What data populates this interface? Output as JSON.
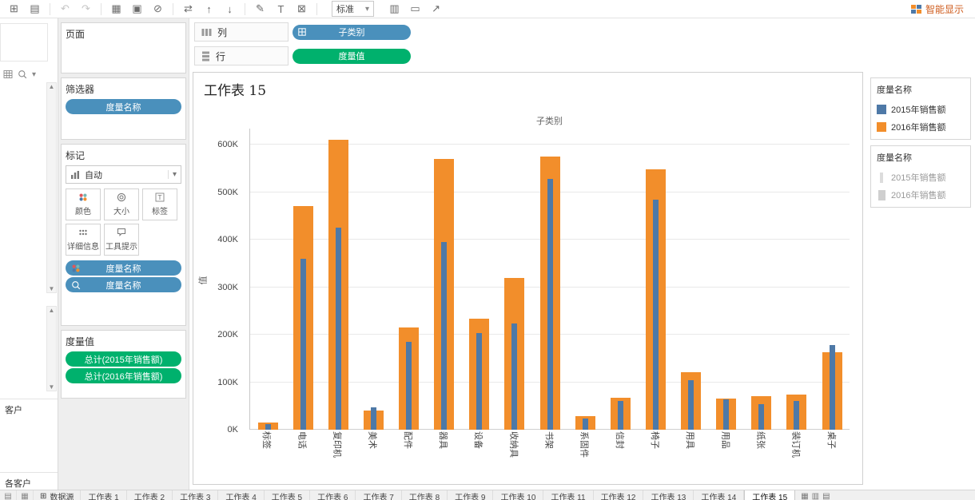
{
  "toolbar": {
    "items": [
      {
        "name": "new-workbook-icon",
        "glyph": "⊞"
      },
      {
        "name": "open-file-icon",
        "glyph": "▤"
      },
      {
        "type": "divider"
      },
      {
        "name": "undo-icon",
        "glyph": "↶",
        "muted": true
      },
      {
        "name": "redo-icon",
        "glyph": "↷",
        "muted": true
      },
      {
        "type": "divider"
      },
      {
        "name": "new-worksheet-icon",
        "glyph": "▦"
      },
      {
        "name": "duplicate-sheet-icon",
        "glyph": "▣"
      },
      {
        "name": "clear-sheet-icon",
        "glyph": "⊘"
      },
      {
        "type": "divider"
      },
      {
        "name": "swap-axes-icon",
        "glyph": "⇄"
      },
      {
        "name": "sort-ascending-icon",
        "glyph": "↑"
      },
      {
        "name": "sort-descending-icon",
        "glyph": "↓"
      },
      {
        "type": "divider"
      },
      {
        "name": "highlight-icon",
        "glyph": "✎"
      },
      {
        "name": "show-mark-labels-icon",
        "glyph": "T"
      },
      {
        "name": "fix-axes-icon",
        "glyph": "⊠"
      },
      {
        "type": "divider"
      }
    ],
    "fit_label": "标准",
    "right_items": [
      {
        "name": "show-hide-cards-icon",
        "glyph": "▥"
      },
      {
        "name": "presentation-mode-icon",
        "glyph": "▭"
      },
      {
        "name": "share-icon",
        "glyph": "↗"
      }
    ],
    "show_me_label": "智能显示"
  },
  "data_pane": {
    "labels": [
      "客户",
      "各客户"
    ]
  },
  "shelves": {
    "columns": {
      "label": "列",
      "pills": [
        {
          "label": "子类别",
          "icon": "field-icon",
          "color_key": "dimension"
        }
      ]
    },
    "rows": {
      "label": "行",
      "pills": [
        {
          "label": "度量值",
          "color_key": "measure"
        }
      ]
    }
  },
  "cards": {
    "pages": {
      "title": "页面"
    },
    "filters": {
      "title": "筛选器",
      "pills": [
        {
          "label": "度量名称",
          "color_key": "dimension"
        }
      ]
    },
    "marks": {
      "title": "标记",
      "mark_type_label": "自动",
      "buttons": [
        {
          "name": "color-button",
          "label": "颜色",
          "icon": "color-icon"
        },
        {
          "name": "size-button",
          "label": "大小",
          "icon": "size-icon"
        },
        {
          "name": "label-button",
          "label": "标签",
          "icon": "label-icon"
        },
        {
          "name": "detail-button",
          "label": "详细信息",
          "icon": "detail-icon"
        },
        {
          "name": "tooltip-button",
          "label": "工具提示",
          "icon": "tooltip-icon"
        }
      ],
      "pills": [
        {
          "label": "度量名称",
          "icon": "color-icon",
          "color_key": "dimension"
        },
        {
          "label": "度量名称",
          "icon": "lens-icon",
          "color_key": "dimension"
        }
      ]
    },
    "measure_values": {
      "title": "度量值",
      "pills": [
        {
          "label": "总计(2015年销售额)",
          "color_key": "measure"
        },
        {
          "label": "总计(2016年销售额)",
          "color_key": "measure"
        }
      ]
    }
  },
  "colors": {
    "dimension_pill": "#4a90bc",
    "measure_pill": "#00b16d",
    "bar_blue": "#4e79a7",
    "bar_orange": "#f28e2b"
  },
  "chart_data": {
    "type": "bar",
    "title": "工作表 15",
    "column_field_label": "子类别",
    "ylabel": "值",
    "ylim_k": [
      0,
      600
    ],
    "yticks": [
      "0K",
      "100K",
      "200K",
      "300K",
      "400K",
      "500K",
      "600K"
    ],
    "grid": true,
    "legend_position": "right",
    "categories": [
      "标签",
      "电话",
      "复印机",
      "美术",
      "配件",
      "器具",
      "设备",
      "收纳具",
      "书架",
      "系固件",
      "信封",
      "椅子",
      "用具",
      "用品",
      "纸张",
      "装订机",
      "桌子"
    ],
    "series": [
      {
        "name": "2015年销售额",
        "color": "#4e79a7",
        "size": "small",
        "values_k": [
          12,
          360,
          425,
          47,
          185,
          395,
          203,
          224,
          527,
          24,
          60,
          484,
          104,
          64,
          54,
          60,
          179
        ]
      },
      {
        "name": "2016年销售额",
        "color": "#f28e2b",
        "size": "large",
        "values_k": [
          15,
          470,
          610,
          40,
          215,
          570,
          233,
          320,
          575,
          28,
          68,
          548,
          121,
          65,
          70,
          74,
          163
        ]
      }
    ]
  },
  "legends": [
    {
      "title": "度量名称",
      "kind": "color",
      "items": [
        {
          "label": "2015年销售额",
          "color": "#4e79a7"
        },
        {
          "label": "2016年销售额",
          "color": "#f28e2b"
        }
      ]
    },
    {
      "title": "度量名称",
      "kind": "size",
      "items": [
        {
          "label": "2015年销售额",
          "size": "small"
        },
        {
          "label": "2016年销售额",
          "size": "large"
        }
      ]
    }
  ],
  "tabs": {
    "left_icons": [
      {
        "name": "show-filmstrip-icon",
        "glyph": "▤"
      },
      {
        "name": "show-sheet-sorter-icon",
        "glyph": "▦"
      }
    ],
    "datasource_label": "数据源",
    "sheets": [
      "工作表 1",
      "工作表 2",
      "工作表 3",
      "工作表 4",
      "工作表 5",
      "工作表 6",
      "工作表 7",
      "工作表 8",
      "工作表 9",
      "工作表 10",
      "工作表 11",
      "工作表 12",
      "工作表 13",
      "工作表 14",
      "工作表 15"
    ],
    "active": "工作表 15",
    "new_icons": [
      {
        "name": "new-worksheet-tab-icon",
        "glyph": "▦"
      },
      {
        "name": "new-dashboard-tab-icon",
        "glyph": "▥"
      },
      {
        "name": "new-story-tab-icon",
        "glyph": "▤"
      }
    ]
  }
}
